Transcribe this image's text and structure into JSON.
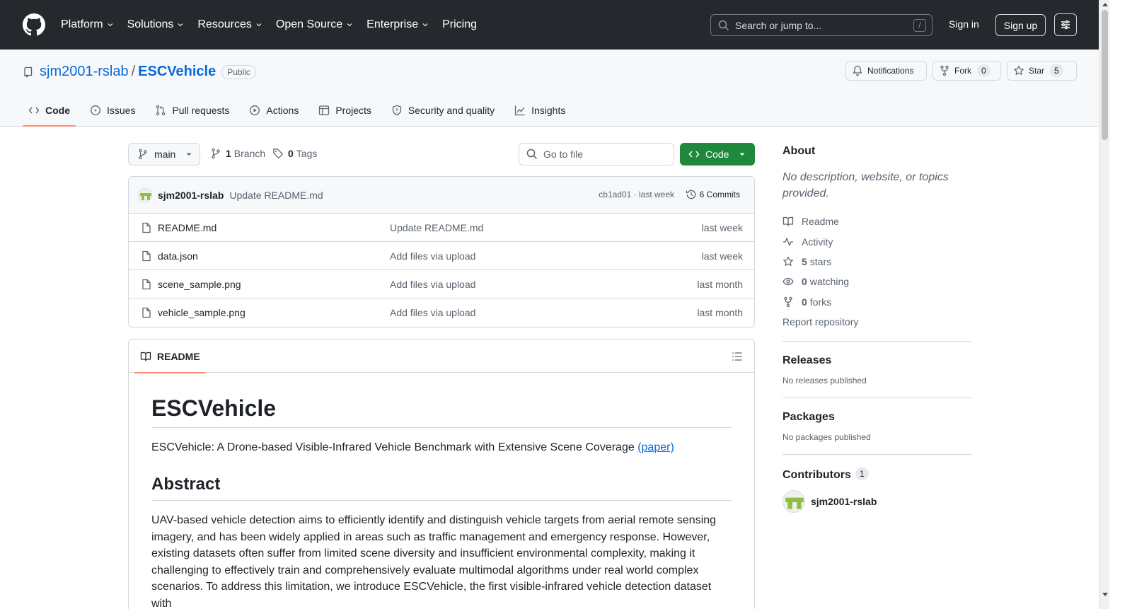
{
  "header": {
    "nav": [
      "Platform",
      "Solutions",
      "Resources",
      "Open Source",
      "Enterprise",
      "Pricing"
    ],
    "search_placeholder": "Search or jump to...",
    "search_shortcut": "/",
    "sign_in": "Sign in",
    "sign_up": "Sign up"
  },
  "repo": {
    "owner": "sjm2001-rslab",
    "separator": "/",
    "name": "ESCVehicle",
    "visibility": "Public",
    "notifications": "Notifications",
    "fork_label": "Fork",
    "fork_count": "0",
    "star_label": "Star",
    "star_count": "5",
    "tabs": [
      "Code",
      "Issues",
      "Pull requests",
      "Actions",
      "Projects",
      "Security and quality",
      "Insights"
    ]
  },
  "toolbar": {
    "branch": "main",
    "branch_count": "1",
    "branch_label": "Branch",
    "tag_count": "0",
    "tag_label": "Tags",
    "go_to_file": "Go to file",
    "code_button": "Code"
  },
  "commit": {
    "author": "sjm2001-rslab",
    "message": "Update README.md",
    "meta": "cb1ad01 · last week",
    "commits": "6 Commits"
  },
  "files": [
    {
      "name": "README.md",
      "message": "Update README.md",
      "date": "last week"
    },
    {
      "name": "data.json",
      "message": "Add files via upload",
      "date": "last week"
    },
    {
      "name": "scene_sample.png",
      "message": "Add files via upload",
      "date": "last month"
    },
    {
      "name": "vehicle_sample.png",
      "message": "Add files via upload",
      "date": "last month"
    }
  ],
  "readme": {
    "tab": "README",
    "title": "ESCVehicle",
    "lead": "ESCVehicle: A Drone-based Visible-Infrared Vehicle Benchmark with Extensive Scene Coverage",
    "lead_link": "(paper)",
    "abstract_heading": "Abstract",
    "abstract": "UAV-based vehicle detection aims to efficiently identify and distinguish vehicle targets from aerial remote sensing imagery, and has been widely applied in areas such as traffic management and emergency response. However, existing datasets often suffer from limited scene diversity and insufficient environmental complexity, making it challenging to effectively train and comprehensively evaluate multimodal algorithms under real world complex scenarios. To address this limitation, we introduce ESCVehicle, the first visible-infrared vehicle detection dataset with"
  },
  "sidebar": {
    "about_heading": "About",
    "about_desc": "No description, website, or topics provided.",
    "readme": "Readme",
    "activity": "Activity",
    "stars_count": "5",
    "stars_label": "stars",
    "watching_count": "0",
    "watching_label": "watching",
    "forks_count": "0",
    "forks_label": "forks",
    "report": "Report repository",
    "releases_heading": "Releases",
    "releases_text": "No releases published",
    "packages_heading": "Packages",
    "packages_text": "No packages published",
    "contributors_heading": "Contributors",
    "contributors_count": "1",
    "contributor": "sjm2001-rslab"
  },
  "colors": {
    "header_bg": "#25292e",
    "accent_link": "#0969da",
    "code_button": "#1f883d",
    "tab_underline": "#fd8c73"
  }
}
